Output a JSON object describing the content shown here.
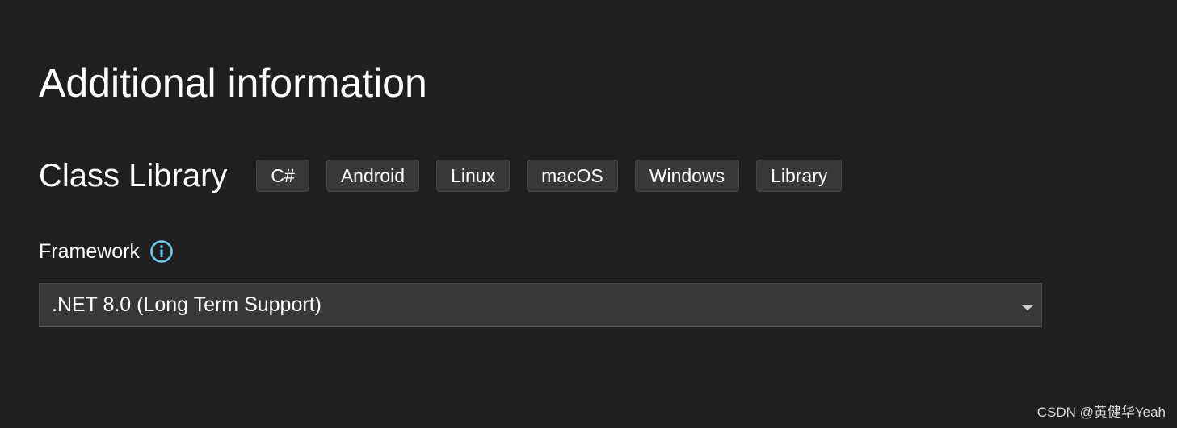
{
  "title": "Additional information",
  "template": {
    "name": "Class Library",
    "tags": [
      "C#",
      "Android",
      "Linux",
      "macOS",
      "Windows",
      "Library"
    ]
  },
  "framework": {
    "label": "Framework",
    "info_icon": "info-icon",
    "selected": ".NET 8.0 (Long Term Support)",
    "dropdown_icon": "chevron-down-icon"
  },
  "watermark": "CSDN @黄健华Yeah",
  "colors": {
    "background": "#1f1f1f",
    "tag_background": "#383838",
    "select_background": "#383838",
    "info_accent": "#6ccbf0",
    "text": "#ffffff"
  }
}
